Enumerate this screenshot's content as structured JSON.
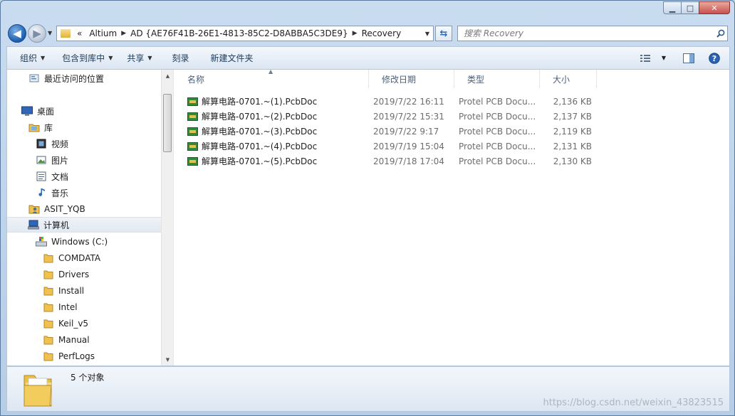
{
  "window": {
    "caption_buttons": [
      "minimize",
      "maximize",
      "close"
    ]
  },
  "address": {
    "overflow": "«",
    "segments": [
      "Altium",
      "AD {AE76F41B-26E1-4813-85C2-D8ABBA5C3DE9}",
      "Recovery"
    ]
  },
  "search": {
    "placeholder": "搜索 Recovery"
  },
  "toolbar": {
    "organize": "组织",
    "include_in_library": "包含到库中",
    "share": "共享",
    "burn": "刻录",
    "new_folder": "新建文件夹"
  },
  "sidebar": {
    "items": [
      {
        "label": "最近访问的位置",
        "icon": "recent-places-icon"
      },
      {
        "label": "桌面",
        "icon": "desktop-icon"
      },
      {
        "label": "库",
        "icon": "library-icon"
      },
      {
        "label": "视频",
        "icon": "video-icon"
      },
      {
        "label": "图片",
        "icon": "picture-icon"
      },
      {
        "label": "文档",
        "icon": "document-icon"
      },
      {
        "label": "音乐",
        "icon": "music-icon"
      },
      {
        "label": "ASIT_YQB",
        "icon": "user-icon"
      },
      {
        "label": "计算机",
        "icon": "computer-icon"
      },
      {
        "label": "Windows (C:)",
        "icon": "drive-icon"
      },
      {
        "label": "COMDATA",
        "icon": "folder-icon"
      },
      {
        "label": "Drivers",
        "icon": "folder-icon"
      },
      {
        "label": "Install",
        "icon": "folder-icon"
      },
      {
        "label": "Intel",
        "icon": "folder-icon"
      },
      {
        "label": "Keil_v5",
        "icon": "folder-icon"
      },
      {
        "label": "Manual",
        "icon": "folder-icon"
      },
      {
        "label": "PerfLogs",
        "icon": "folder-icon"
      }
    ],
    "selected": "计算机"
  },
  "files": {
    "columns": {
      "name": "名称",
      "date": "修改日期",
      "type": "类型",
      "size": "大小"
    },
    "rows": [
      {
        "name": "解算电路-0701.~(1).PcbDoc",
        "date": "2019/7/22 16:11",
        "type": "Protel PCB Docu...",
        "size": "2,136 KB"
      },
      {
        "name": "解算电路-0701.~(2).PcbDoc",
        "date": "2019/7/22 15:31",
        "type": "Protel PCB Docu...",
        "size": "2,137 KB"
      },
      {
        "name": "解算电路-0701.~(3).PcbDoc",
        "date": "2019/7/22 9:17",
        "type": "Protel PCB Docu...",
        "size": "2,119 KB"
      },
      {
        "name": "解算电路-0701.~(4).PcbDoc",
        "date": "2019/7/19 15:04",
        "type": "Protel PCB Docu...",
        "size": "2,131 KB"
      },
      {
        "name": "解算电路-0701.~(5).PcbDoc",
        "date": "2019/7/18 17:04",
        "type": "Protel PCB Docu...",
        "size": "2,130 KB"
      }
    ]
  },
  "details": {
    "count_text": "5 个对象"
  },
  "watermark": "https://blog.csdn.net/weixin_43823515",
  "colors": {
    "accent": "#1c5dad",
    "folder": "#e8c048",
    "selection": "#e3e9f1"
  }
}
